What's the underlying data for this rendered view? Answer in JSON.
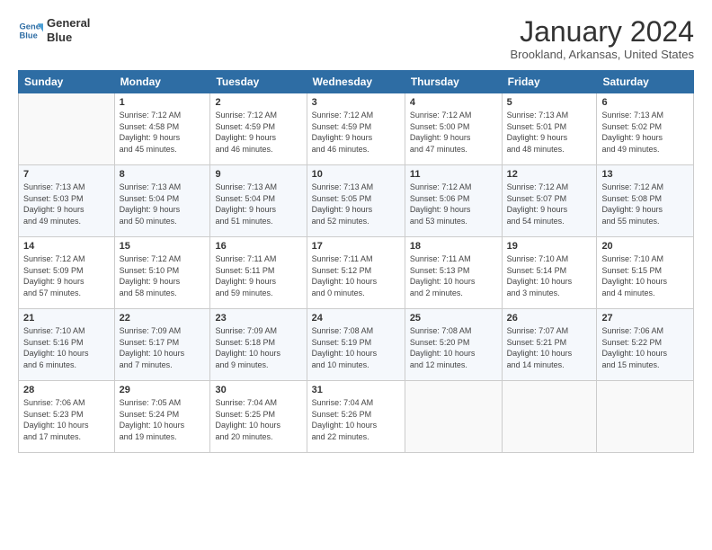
{
  "logo": {
    "line1": "General",
    "line2": "Blue"
  },
  "header": {
    "title": "January 2024",
    "subtitle": "Brookland, Arkansas, United States"
  },
  "weekdays": [
    "Sunday",
    "Monday",
    "Tuesday",
    "Wednesday",
    "Thursday",
    "Friday",
    "Saturday"
  ],
  "weeks": [
    [
      {
        "day": "",
        "info": ""
      },
      {
        "day": "1",
        "info": "Sunrise: 7:12 AM\nSunset: 4:58 PM\nDaylight: 9 hours\nand 45 minutes."
      },
      {
        "day": "2",
        "info": "Sunrise: 7:12 AM\nSunset: 4:59 PM\nDaylight: 9 hours\nand 46 minutes."
      },
      {
        "day": "3",
        "info": "Sunrise: 7:12 AM\nSunset: 4:59 PM\nDaylight: 9 hours\nand 46 minutes."
      },
      {
        "day": "4",
        "info": "Sunrise: 7:12 AM\nSunset: 5:00 PM\nDaylight: 9 hours\nand 47 minutes."
      },
      {
        "day": "5",
        "info": "Sunrise: 7:13 AM\nSunset: 5:01 PM\nDaylight: 9 hours\nand 48 minutes."
      },
      {
        "day": "6",
        "info": "Sunrise: 7:13 AM\nSunset: 5:02 PM\nDaylight: 9 hours\nand 49 minutes."
      }
    ],
    [
      {
        "day": "7",
        "info": "Sunrise: 7:13 AM\nSunset: 5:03 PM\nDaylight: 9 hours\nand 49 minutes."
      },
      {
        "day": "8",
        "info": "Sunrise: 7:13 AM\nSunset: 5:04 PM\nDaylight: 9 hours\nand 50 minutes."
      },
      {
        "day": "9",
        "info": "Sunrise: 7:13 AM\nSunset: 5:04 PM\nDaylight: 9 hours\nand 51 minutes."
      },
      {
        "day": "10",
        "info": "Sunrise: 7:13 AM\nSunset: 5:05 PM\nDaylight: 9 hours\nand 52 minutes."
      },
      {
        "day": "11",
        "info": "Sunrise: 7:12 AM\nSunset: 5:06 PM\nDaylight: 9 hours\nand 53 minutes."
      },
      {
        "day": "12",
        "info": "Sunrise: 7:12 AM\nSunset: 5:07 PM\nDaylight: 9 hours\nand 54 minutes."
      },
      {
        "day": "13",
        "info": "Sunrise: 7:12 AM\nSunset: 5:08 PM\nDaylight: 9 hours\nand 55 minutes."
      }
    ],
    [
      {
        "day": "14",
        "info": "Sunrise: 7:12 AM\nSunset: 5:09 PM\nDaylight: 9 hours\nand 57 minutes."
      },
      {
        "day": "15",
        "info": "Sunrise: 7:12 AM\nSunset: 5:10 PM\nDaylight: 9 hours\nand 58 minutes."
      },
      {
        "day": "16",
        "info": "Sunrise: 7:11 AM\nSunset: 5:11 PM\nDaylight: 9 hours\nand 59 minutes."
      },
      {
        "day": "17",
        "info": "Sunrise: 7:11 AM\nSunset: 5:12 PM\nDaylight: 10 hours\nand 0 minutes."
      },
      {
        "day": "18",
        "info": "Sunrise: 7:11 AM\nSunset: 5:13 PM\nDaylight: 10 hours\nand 2 minutes."
      },
      {
        "day": "19",
        "info": "Sunrise: 7:10 AM\nSunset: 5:14 PM\nDaylight: 10 hours\nand 3 minutes."
      },
      {
        "day": "20",
        "info": "Sunrise: 7:10 AM\nSunset: 5:15 PM\nDaylight: 10 hours\nand 4 minutes."
      }
    ],
    [
      {
        "day": "21",
        "info": "Sunrise: 7:10 AM\nSunset: 5:16 PM\nDaylight: 10 hours\nand 6 minutes."
      },
      {
        "day": "22",
        "info": "Sunrise: 7:09 AM\nSunset: 5:17 PM\nDaylight: 10 hours\nand 7 minutes."
      },
      {
        "day": "23",
        "info": "Sunrise: 7:09 AM\nSunset: 5:18 PM\nDaylight: 10 hours\nand 9 minutes."
      },
      {
        "day": "24",
        "info": "Sunrise: 7:08 AM\nSunset: 5:19 PM\nDaylight: 10 hours\nand 10 minutes."
      },
      {
        "day": "25",
        "info": "Sunrise: 7:08 AM\nSunset: 5:20 PM\nDaylight: 10 hours\nand 12 minutes."
      },
      {
        "day": "26",
        "info": "Sunrise: 7:07 AM\nSunset: 5:21 PM\nDaylight: 10 hours\nand 14 minutes."
      },
      {
        "day": "27",
        "info": "Sunrise: 7:06 AM\nSunset: 5:22 PM\nDaylight: 10 hours\nand 15 minutes."
      }
    ],
    [
      {
        "day": "28",
        "info": "Sunrise: 7:06 AM\nSunset: 5:23 PM\nDaylight: 10 hours\nand 17 minutes."
      },
      {
        "day": "29",
        "info": "Sunrise: 7:05 AM\nSunset: 5:24 PM\nDaylight: 10 hours\nand 19 minutes."
      },
      {
        "day": "30",
        "info": "Sunrise: 7:04 AM\nSunset: 5:25 PM\nDaylight: 10 hours\nand 20 minutes."
      },
      {
        "day": "31",
        "info": "Sunrise: 7:04 AM\nSunset: 5:26 PM\nDaylight: 10 hours\nand 22 minutes."
      },
      {
        "day": "",
        "info": ""
      },
      {
        "day": "",
        "info": ""
      },
      {
        "day": "",
        "info": ""
      }
    ]
  ]
}
